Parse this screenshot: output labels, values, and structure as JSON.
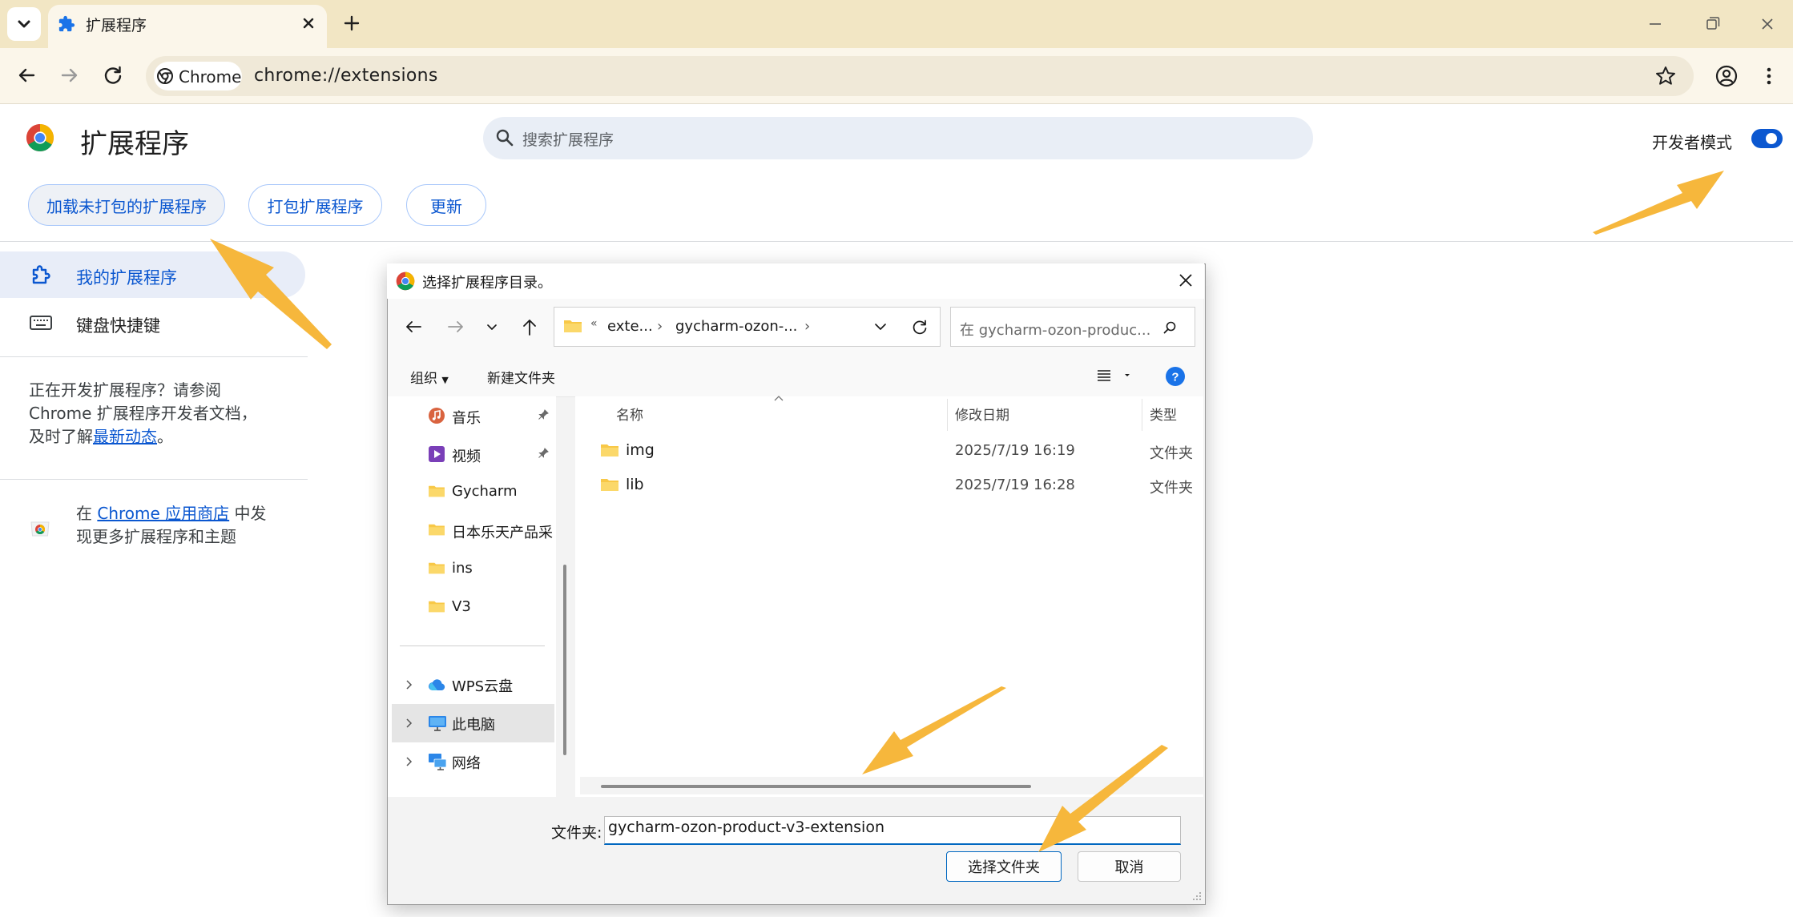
{
  "browser": {
    "tab_title": "扩展程序",
    "omnibox_chip": "Chrome",
    "url": "chrome://extensions"
  },
  "page": {
    "title": "扩展程序",
    "search_placeholder": "搜索扩展程序",
    "developer_mode_label": "开发者模式",
    "developer_mode_on": true,
    "buttons": {
      "load_unpacked": "加载未打包的扩展程序",
      "pack": "打包扩展程序",
      "update": "更新"
    },
    "sidebar": {
      "items": [
        {
          "label": "我的扩展程序",
          "active": true
        },
        {
          "label": "键盘快捷键",
          "active": false
        }
      ],
      "dev_note_line1": "正在开发扩展程序？请参阅",
      "dev_note_line2": "Chrome 扩展程序开发者文档，",
      "dev_note_line3_prefix": "及时了解",
      "dev_note_link": "最新动态",
      "dev_note_suffix": "。",
      "store_prefix": "在 ",
      "store_link": "Chrome 应用商店",
      "store_mid": " 中发",
      "store_line2": "现更多扩展程序和主题"
    }
  },
  "dialog": {
    "title": "选择扩展程序目录。",
    "breadcrumb": {
      "overflow": "«",
      "segments": [
        "exte...",
        "gycharm-ozon-..."
      ]
    },
    "search_placeholder": "在 gycharm-ozon-produc...",
    "commands": {
      "organize": "组织",
      "new_folder": "新建文件夹"
    },
    "nav_items": [
      {
        "label": "音乐",
        "icon": "music-icon",
        "pinned": true
      },
      {
        "label": "视频",
        "icon": "video-icon",
        "pinned": true
      },
      {
        "label": "Gycharm",
        "icon": "folder-icon",
        "pinned": false
      },
      {
        "label": "日本乐天产品采",
        "icon": "folder-icon",
        "pinned": false
      },
      {
        "label": "ins",
        "icon": "folder-icon",
        "pinned": false
      },
      {
        "label": "V3",
        "icon": "folder-icon",
        "pinned": false
      }
    ],
    "nav_roots": [
      {
        "label": "WPS云盘",
        "icon": "cloud-icon",
        "selected": false
      },
      {
        "label": "此电脑",
        "icon": "computer-icon",
        "selected": true
      },
      {
        "label": "网络",
        "icon": "network-icon",
        "selected": false
      }
    ],
    "columns": {
      "name": "名称",
      "date": "修改日期",
      "type": "类型"
    },
    "files": [
      {
        "name": "img",
        "date": "2025/7/19 16:19",
        "type": "文件夹"
      },
      {
        "name": "lib",
        "date": "2025/7/19 16:28",
        "type": "文件夹"
      }
    ],
    "folder_label": "文件夹:",
    "folder_value": "gycharm-ozon-product-v3-extension",
    "select_button": "选择文件夹",
    "cancel_button": "取消"
  },
  "colors": {
    "tabstrip": "#f2e6c4",
    "toolbar": "#fbf6ea",
    "accent": "#0b57d0",
    "annotation_arrow": "#f6b73c"
  }
}
